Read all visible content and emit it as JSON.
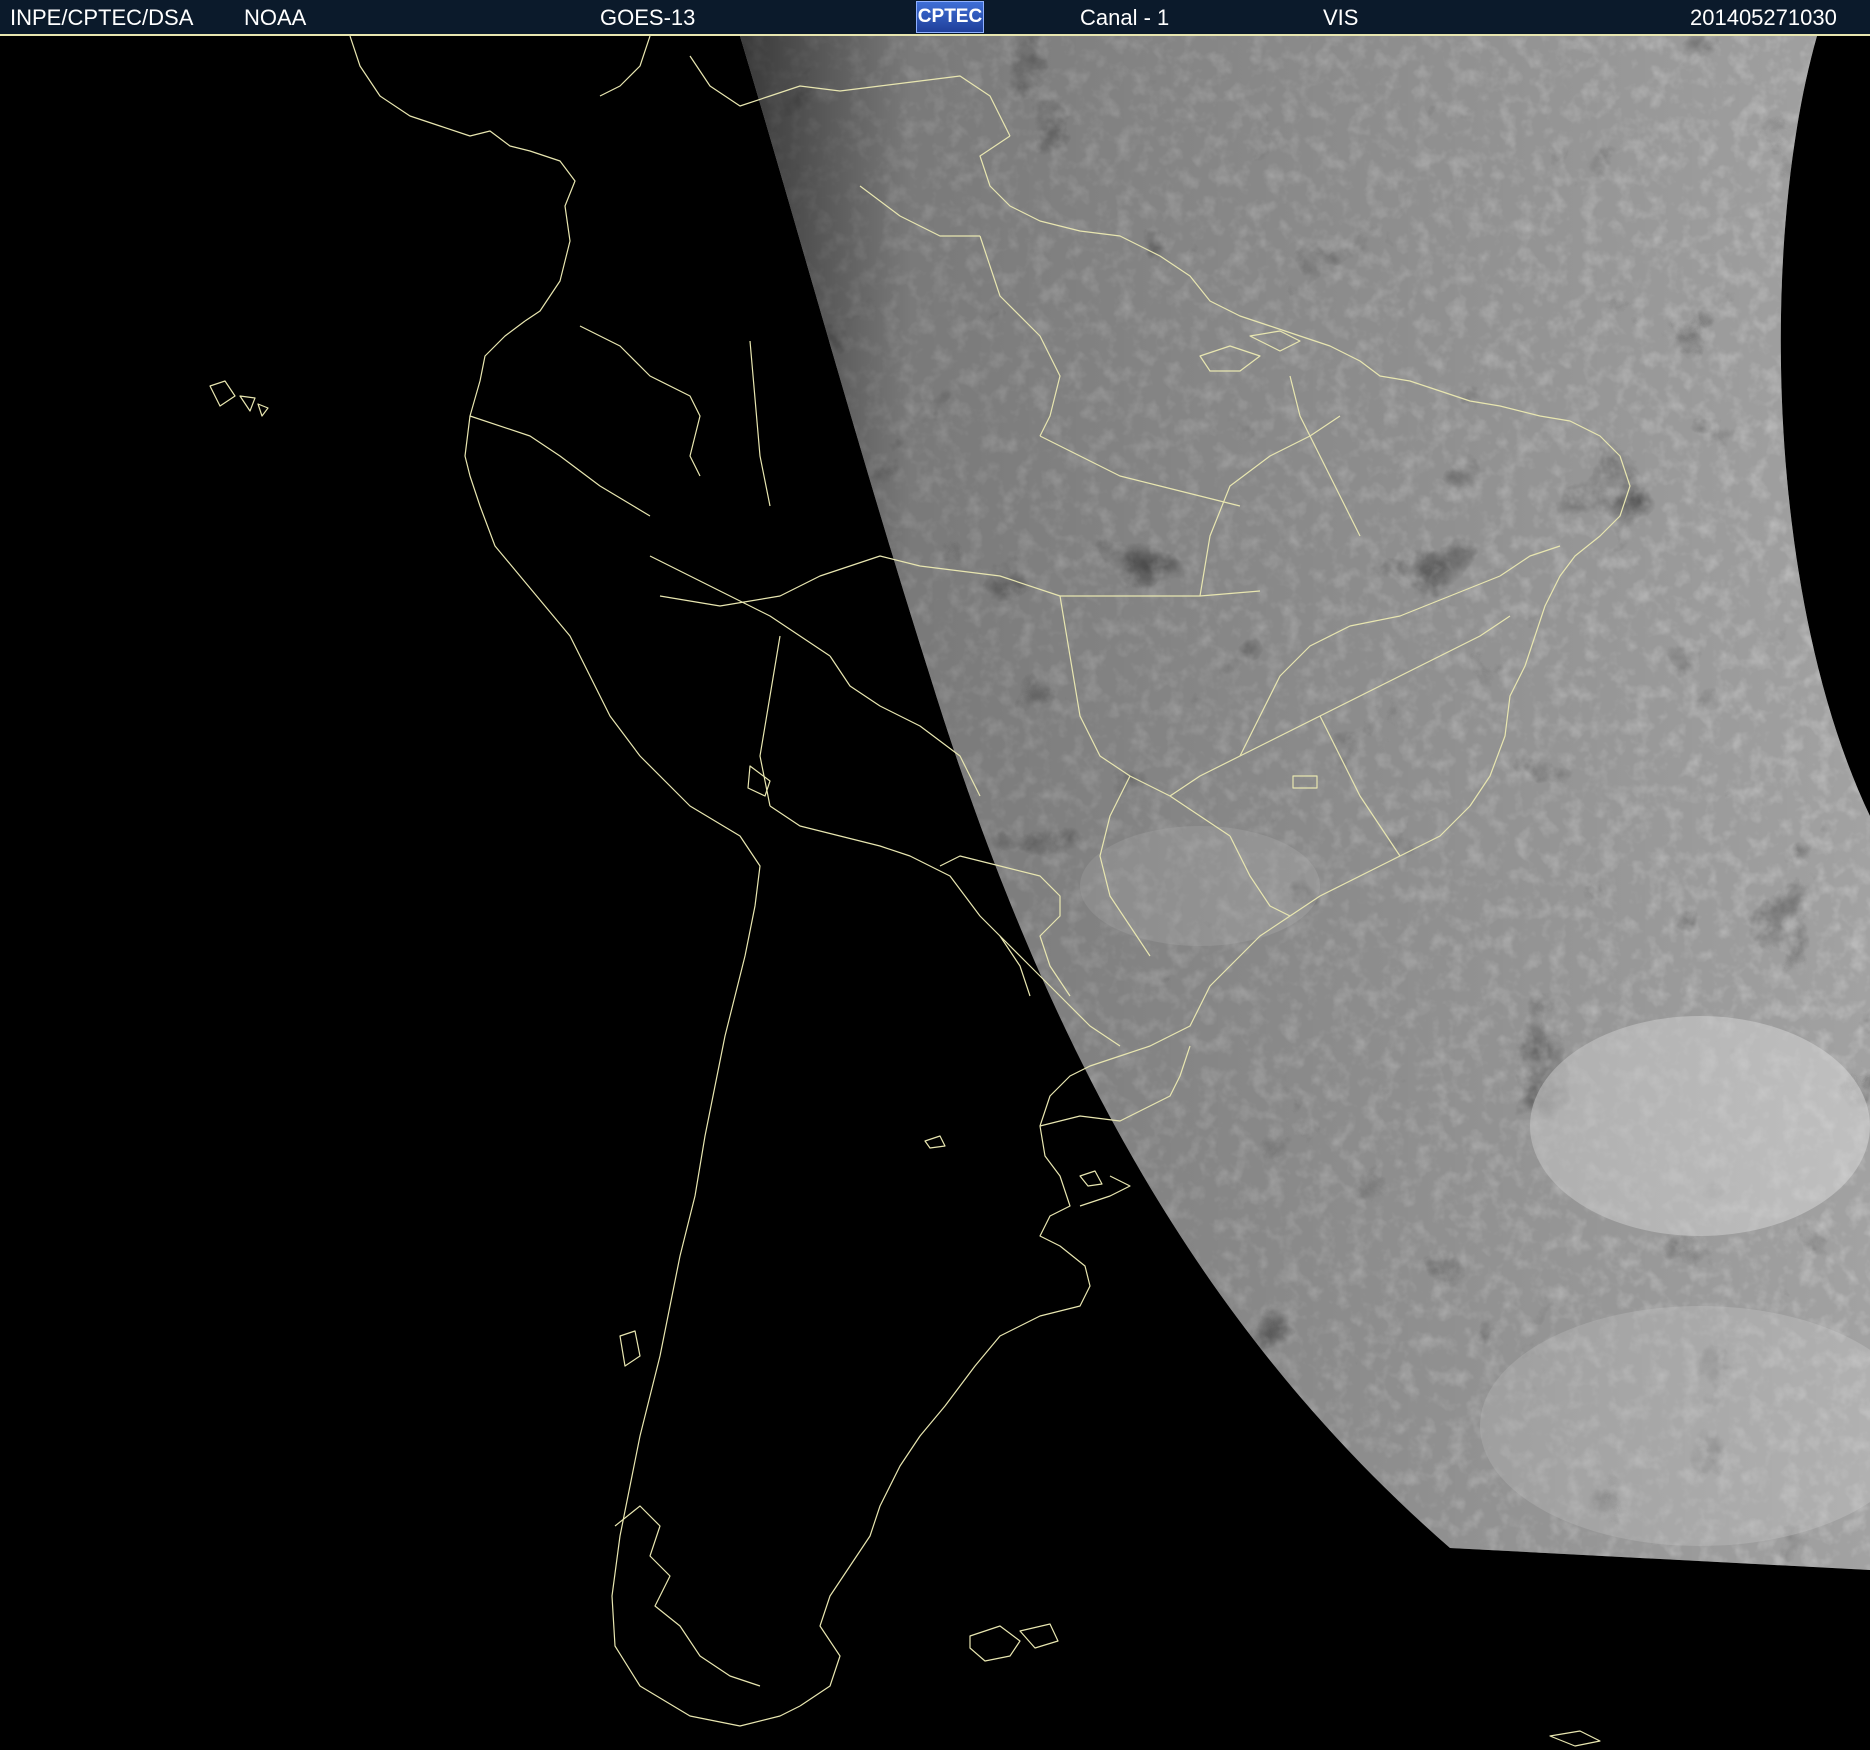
{
  "header": {
    "org": "INPE/CPTEC/DSA",
    "agency": "NOAA",
    "satellite": "GOES-13",
    "logo_text": "CPTEC",
    "channel": "Canal - 1",
    "band": "VIS",
    "timestamp": "201405271030"
  },
  "colors": {
    "background": "#000000",
    "header_background": "#0b1a2b",
    "coastline": "#e8e6b0",
    "text": "#ffffff"
  }
}
